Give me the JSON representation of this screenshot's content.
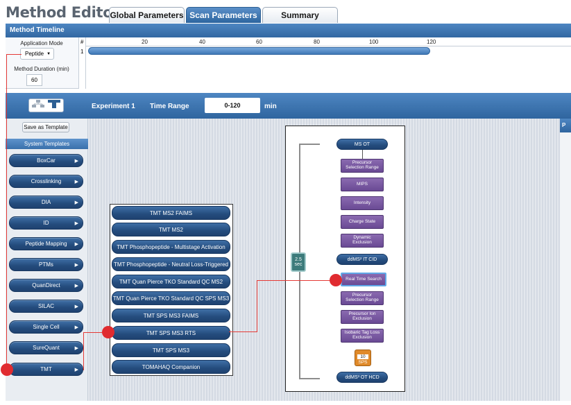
{
  "app": {
    "title": "Method Editor"
  },
  "tabs": [
    {
      "label": "Global Parameters",
      "active": false
    },
    {
      "label": "Scan Parameters",
      "active": true
    },
    {
      "label": "Summary",
      "active": false
    }
  ],
  "timeline": {
    "header": "Method Timeline",
    "application_mode_label": "Application Mode",
    "application_mode_value": "Peptide",
    "duration_label": "Method Duration (min)",
    "duration_value": "60",
    "row_header": "#",
    "row_number": "1",
    "ticks": [
      "20",
      "40",
      "60",
      "80",
      "100",
      "120"
    ]
  },
  "experiment": {
    "name": "Experiment 1",
    "time_range_label": "Time Range",
    "time_range_value": "0-120",
    "time_unit": "min"
  },
  "templates": {
    "save_label": "Save as Template",
    "header": "System Templates",
    "items": [
      "BoxCar",
      "Crosslinking",
      "DIA",
      "ID",
      "Peptide Mapping",
      "PTMs",
      "QuanDirect",
      "SILAC",
      "Single Cell",
      "SureQuant",
      "TMT"
    ]
  },
  "tmt_submenu": {
    "items": [
      "TMT MS2 FAIMS",
      "TMT MS2",
      "TMT Phosphopeptide - Multistage Activation",
      "TMT Phosphopeptide - Neutral Loss-Triggered",
      "TMT Quan Pierce TKO Standard QC MS2",
      "TMT Quan Pierce TKO Standard QC SPS MS3",
      "TMT SPS MS3 FAIMS",
      "TMT SPS MS3 RTS",
      "TMT SPS MS3",
      "TOMAHAQ Companion"
    ]
  },
  "flow": {
    "cycle_value": "2.5",
    "cycle_unit": "sec",
    "ms_ot": "MS OT",
    "nodes_top": [
      [
        "Precursor",
        "Selection Range"
      ],
      [
        "MIPS"
      ],
      [
        "Intensity"
      ],
      [
        "Charge State"
      ],
      [
        "Dynamic",
        "Exclusion"
      ]
    ],
    "ddms_cid": "ddMS² IT CID",
    "real_time_search": "Real Time Search",
    "nodes_bottom": [
      [
        "Precursor",
        "Selection Range"
      ],
      [
        "Precursor Ion",
        "Exclusion"
      ],
      [
        "Isobaric Tag Loss",
        "Exclusion"
      ]
    ],
    "sps_value": "10",
    "sps_label": "SPS",
    "ddms_hcd": "ddMS³ OT HCD"
  },
  "right_panel": {
    "label": "P"
  },
  "colors": {
    "accent": "#3a70ab",
    "button": "#244c7d",
    "filter_node": "#6a4a94",
    "sps": "#e08a2a",
    "annotation": "#e02b30"
  }
}
